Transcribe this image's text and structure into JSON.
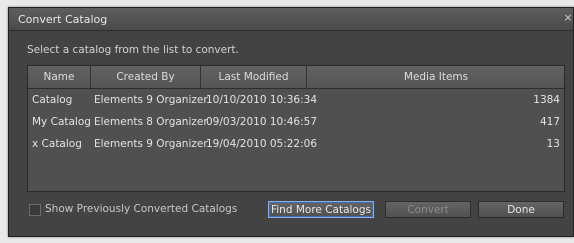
{
  "dialog": {
    "title": "Convert Catalog",
    "close_glyph": "×",
    "instruction": "Select a catalog from the list to convert."
  },
  "table": {
    "columns": [
      "Name",
      "Created By",
      "Last Modified",
      "Media Items"
    ],
    "rows": [
      [
        "Catalog",
        "Elements 9 Organizer",
        "10/10/2010 10:36:34",
        "1384"
      ],
      [
        "My Catalog",
        "Elements 8 Organizer",
        "09/03/2010 10:46:57",
        "417"
      ],
      [
        "x Catalog",
        "Elements 9 Organizer",
        "19/04/2010 05:22:06",
        "13"
      ]
    ]
  },
  "footer": {
    "show_previous_label": "Show Previously Converted Catalogs",
    "show_previous_checked": false,
    "find_more_label": "Find More Catalogs",
    "convert_label": "Convert",
    "done_label": "Done"
  }
}
